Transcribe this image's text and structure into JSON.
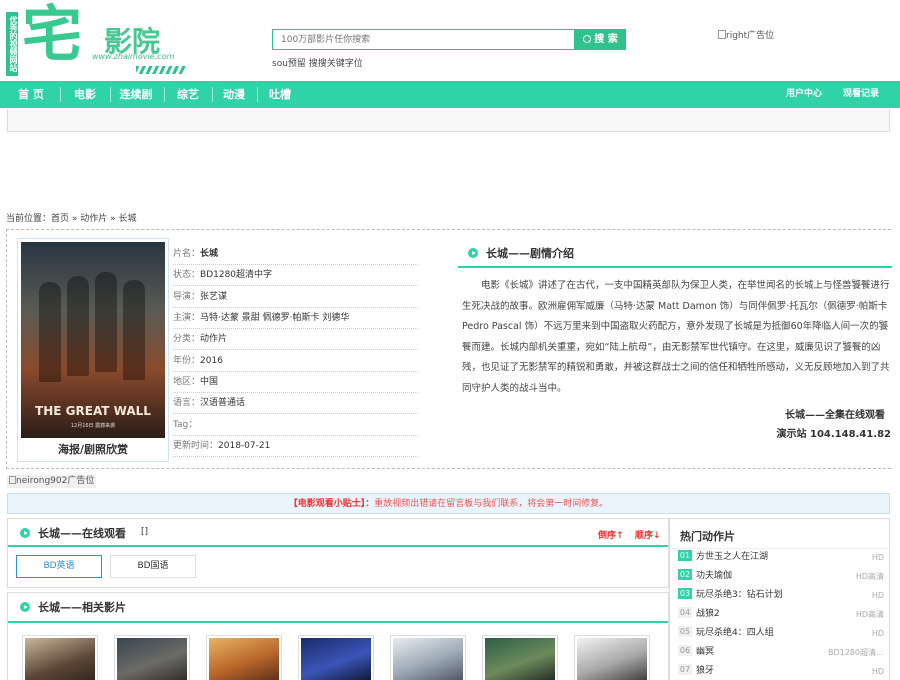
{
  "header": {
    "logo_side": "优秀的视频网站",
    "logo_big": "宅",
    "logo_name": "影院",
    "logo_url": "www.zhaimovie.com",
    "search_placeholder": "100万部影片任你搜索",
    "search_button": "搜 索",
    "search_hint": "sou预留 搜搜关键字位",
    "ad_right": "right广告位"
  },
  "nav": {
    "items": [
      "首 页",
      "电影",
      "连续剧",
      "综艺",
      "动漫",
      "吐槽"
    ],
    "right": [
      "用户中心",
      "观看记录"
    ]
  },
  "breadcrumb": {
    "text": "当前位置：首页 » 动作片 » 长城"
  },
  "movie": {
    "poster_title": "THE GREAT WALL",
    "poster_date": "12月16日 震撼来袭",
    "poster_caption": "海报/剧照欣赏",
    "info": [
      {
        "k": "片名：",
        "v": "长城",
        "bold": true
      },
      {
        "k": "状态：",
        "v": "BD1280超清中字"
      },
      {
        "k": "导演：",
        "v": "张艺谋"
      },
      {
        "k": "主演：",
        "v": "马特·达蒙 景甜 佩德罗·帕斯卡 刘德华"
      },
      {
        "k": "分类：",
        "v": "动作片"
      },
      {
        "k": "年份：",
        "v": "2016"
      },
      {
        "k": "地区：",
        "v": "中国"
      },
      {
        "k": "语言：",
        "v": "汉语普通话"
      },
      {
        "k": "Tag：",
        "v": ""
      },
      {
        "k": "更新时间：",
        "v": "2018-07-21"
      }
    ],
    "plot_title": "长城——剧情介绍",
    "plot": "电影《长城》讲述了在古代，一支中国精英部队为保卫人类，在举世闻名的长城上与怪兽饕餮进行生死决战的故事。欧洲雇佣军威廉（马特·达蒙 Matt Damon 饰）与同伴佩罗·托瓦尔（佩德罗·帕斯卡 Pedro Pascal 饰）不远万里来到中国盗取火药配方，意外发现了长城是为抵御60年降临人间一次的饕餮而建。长城内部机关重重，宛如“陆上航母”，由无影禁军世代镇守。在这里，威廉见识了饕餮的凶残，也见证了无影禁军的精锐和勇敢，并被这群战士之间的信任和牺牲所感动，义无反顾地加入到了共同守护人类的战斗当中。",
    "full_watch": "长城——全集在线观看",
    "demo_site": "演示站 104.148.41.82"
  },
  "ads": {
    "neirong": "neirong902广告位",
    "tip_label": "【电影观看小贴士】：",
    "tip_text": "重放视频出错请在留言板与我们联系，将会第一时间修复。"
  },
  "online": {
    "title": "长城——在线观看",
    "bracket": "[]",
    "desc": "倒序↑",
    "asc": "顺序↓",
    "sources": [
      "BD英语",
      "BD国语"
    ]
  },
  "related": {
    "title": "长城——相关影片"
  },
  "hot": {
    "title": "热门动作片",
    "items": [
      {
        "n": "01",
        "t": "方世玉之人在江湖",
        "q": "HD",
        "color": "#2fd3a7"
      },
      {
        "n": "02",
        "t": "功夫瑜伽",
        "q": "HD高清",
        "color": "#2fd3a7"
      },
      {
        "n": "03",
        "t": "玩尽杀绝3：钻石计划",
        "q": "HD",
        "color": "#2fd3a7"
      },
      {
        "n": "04",
        "t": "战狼2",
        "q": "HD高清",
        "color": "#bbb"
      },
      {
        "n": "05",
        "t": "玩尽杀绝4：四人组",
        "q": "HD",
        "color": "#bbb"
      },
      {
        "n": "06",
        "t": "幽冥",
        "q": "BD1280超清…",
        "color": "#bbb"
      },
      {
        "n": "07",
        "t": "狼牙",
        "q": "HD",
        "color": "#bbb"
      }
    ]
  }
}
